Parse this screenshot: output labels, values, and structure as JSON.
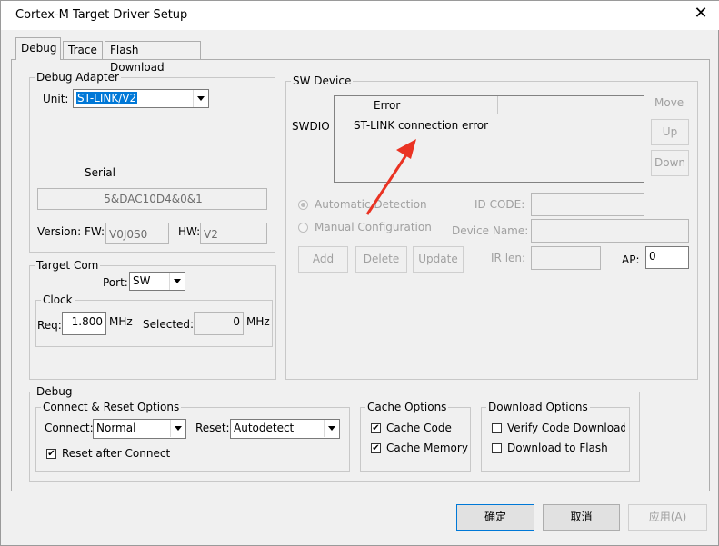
{
  "window": {
    "title": "Cortex-M Target Driver Setup",
    "close_glyph": "✕"
  },
  "tabs": [
    "Debug",
    "Trace",
    "Flash Download"
  ],
  "debug_adapter": {
    "legend": "Debug Adapter",
    "unit_label": "Unit:",
    "unit_value": "ST-LINK/V2",
    "serial_label": "Serial",
    "serial_value": "5&DAC10D4&0&1",
    "version_label": "Version: FW:",
    "fw_value": "V0J0S0",
    "hw_label": "HW:",
    "hw_value": "V2"
  },
  "target_com": {
    "legend": "Target Com",
    "port_label": "Port:",
    "port_value": "SW",
    "clock_legend": "Clock",
    "req_label": "Req:",
    "req_value": "1.800",
    "req_unit": "MHz",
    "selected_label": "Selected:",
    "selected_value": "0",
    "selected_unit": "MHz"
  },
  "sw_device": {
    "legend": "SW Device",
    "swdio_label": "SWDIO",
    "table_header": "Error",
    "table_row": "ST-LINK connection error",
    "move_label": "Move",
    "up_label": "Up",
    "down_label": "Down",
    "auto_detection": "Automatic Detection",
    "manual_config": "Manual Configuration",
    "id_code_label": "ID CODE:",
    "device_name_label": "Device Name:",
    "ir_len_label": "IR len:",
    "ap_label": "AP:",
    "ap_value": "0",
    "add_label": "Add",
    "delete_label": "Delete",
    "update_label": "Update"
  },
  "debug": {
    "legend": "Debug",
    "connect_reset": {
      "legend": "Connect & Reset Options",
      "connect_label": "Connect:",
      "connect_value": "Normal",
      "reset_label": "Reset:",
      "reset_value": "Autodetect",
      "reset_after_connect": "Reset after Connect"
    },
    "cache": {
      "legend": "Cache Options",
      "cache_code": "Cache Code",
      "cache_memory": "Cache Memory"
    },
    "download": {
      "legend": "Download Options",
      "verify": "Verify Code Download",
      "download_flash": "Download to Flash"
    }
  },
  "buttons": {
    "ok": "确定",
    "cancel": "取消",
    "apply": "应用(A)"
  },
  "colors": {
    "annotation_arrow": "#ea3323",
    "selection": "#0078d7"
  }
}
